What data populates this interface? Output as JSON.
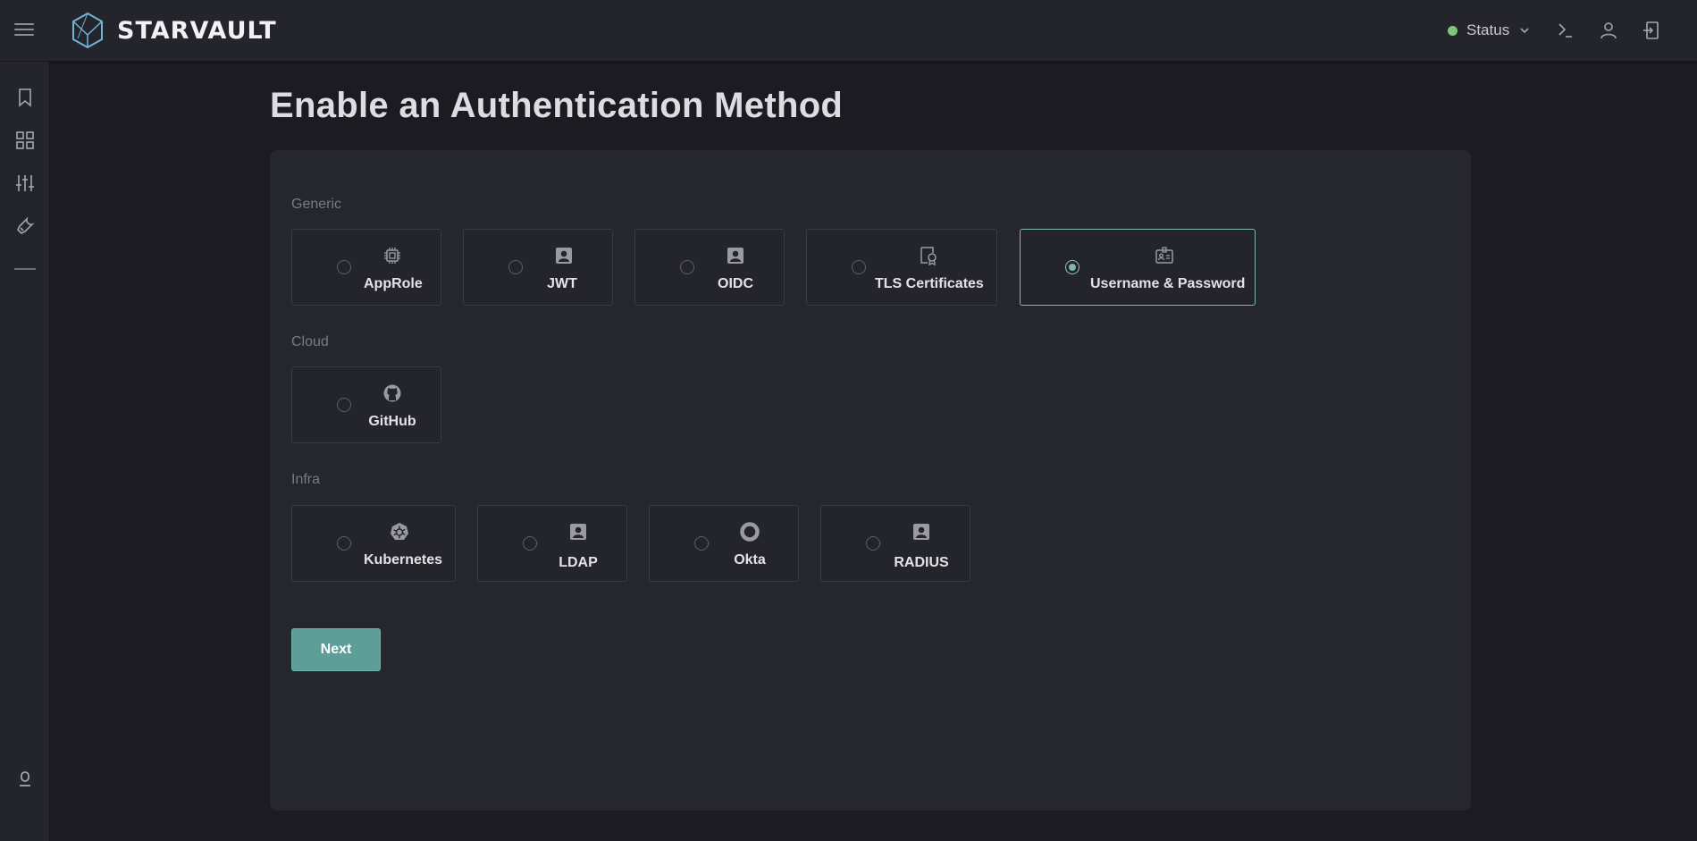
{
  "app": {
    "brand": "STARVAULT"
  },
  "header": {
    "status_label": "Status",
    "status_color": "#7fc47a"
  },
  "sidebar": {
    "items": [
      {
        "icon": "bookmark-icon"
      },
      {
        "icon": "grid-icon"
      },
      {
        "icon": "sliders-icon"
      },
      {
        "icon": "wrench-icon"
      },
      {
        "icon": "divider"
      },
      {
        "icon": "bottom-user-icon"
      }
    ]
  },
  "page": {
    "title": "Enable an Authentication Method"
  },
  "groups": {
    "generic": {
      "label": "Generic",
      "options": [
        {
          "label": "AppRole",
          "icon": "chip-icon",
          "selected": false
        },
        {
          "label": "JWT",
          "icon": "id-badge-icon",
          "selected": false
        },
        {
          "label": "OIDC",
          "icon": "id-badge-icon",
          "selected": false
        },
        {
          "label": "TLS Certificates",
          "icon": "certificate-icon",
          "selected": false
        },
        {
          "label": "Username & Password",
          "icon": "id-card-icon",
          "selected": true
        }
      ]
    },
    "cloud": {
      "label": "Cloud",
      "options": [
        {
          "label": "GitHub",
          "icon": "github-icon",
          "selected": false
        }
      ]
    },
    "infra": {
      "label": "Infra",
      "options": [
        {
          "label": "Kubernetes",
          "icon": "kubernetes-icon",
          "selected": false
        },
        {
          "label": "LDAP",
          "icon": "id-badge-icon",
          "selected": false
        },
        {
          "label": "Okta",
          "icon": "okta-icon",
          "selected": false
        },
        {
          "label": "RADIUS",
          "icon": "id-badge-icon",
          "selected": false
        }
      ]
    }
  },
  "actions": {
    "next_label": "Next"
  },
  "colors": {
    "accent": "#5f9e98",
    "selected_border": "#7fb7b0"
  }
}
